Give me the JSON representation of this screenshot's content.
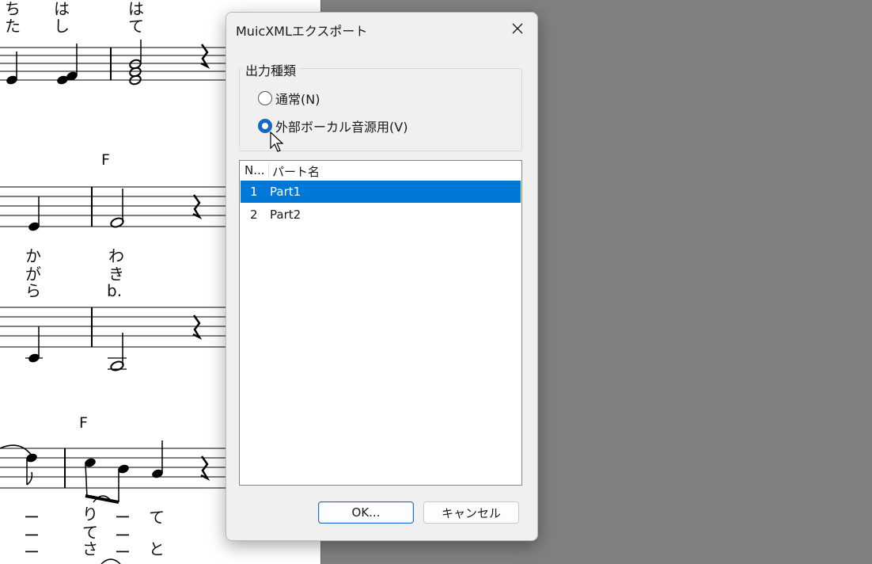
{
  "score": {
    "lyrics": {
      "row1_top": [
        "ち",
        "は",
        "は"
      ],
      "row1_bottom": [
        "た",
        "し",
        "て"
      ],
      "row3_col1": [
        "か",
        "が",
        "ら"
      ],
      "row3_col2": [
        "わ",
        "き",
        "b."
      ],
      "row5_col1": [
        "ー",
        "ー",
        "ー"
      ],
      "row5_col2": [
        "り",
        "て",
        "さ"
      ],
      "row5_col3": [
        "ー",
        "ー",
        "ー"
      ],
      "row5_col4": [
        "て",
        "",
        "と"
      ]
    },
    "chords": [
      "F",
      "F"
    ]
  },
  "dialog": {
    "title": "MuicXMLエクスポート",
    "group": {
      "label": "出力種類",
      "options": [
        {
          "label": "通常(N)",
          "selected": false
        },
        {
          "label": "外部ボーカル音源用(V)",
          "selected": true
        }
      ]
    },
    "list": {
      "columns": [
        "N...",
        "パート名"
      ],
      "rows": [
        {
          "no": "1",
          "name": "Part1",
          "selected": true
        },
        {
          "no": "2",
          "name": "Part2",
          "selected": false
        }
      ]
    },
    "buttons": {
      "ok": "OK...",
      "cancel": "キャンセル"
    }
  },
  "colors": {
    "accent": "#0078d7",
    "radio_selected": "#1668c4",
    "background": "#808080",
    "dialog": "#f0f0f0"
  }
}
